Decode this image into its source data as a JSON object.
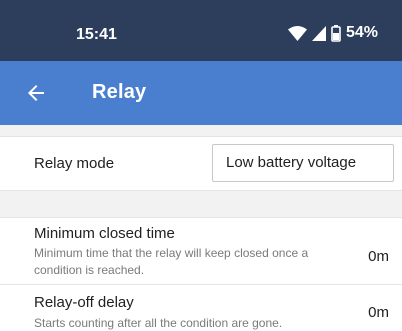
{
  "status_bar": {
    "time": "15:41",
    "battery_percent": "54%",
    "icons": [
      "wifi-icon",
      "signal-icon",
      "battery-icon"
    ]
  },
  "app_bar": {
    "back_icon": "arrow-back-icon",
    "title": "Relay",
    "color": "#4a7fd0"
  },
  "relay_mode": {
    "label": "Relay mode",
    "selected": "Low battery voltage"
  },
  "settings": [
    {
      "title": "Minimum closed time",
      "description": "Minimum time that the relay will keep closed once a condition is reached.",
      "value": "0m"
    },
    {
      "title": "Relay-off delay",
      "description": "Starts counting after all the condition are gone.",
      "value": "0m"
    }
  ]
}
